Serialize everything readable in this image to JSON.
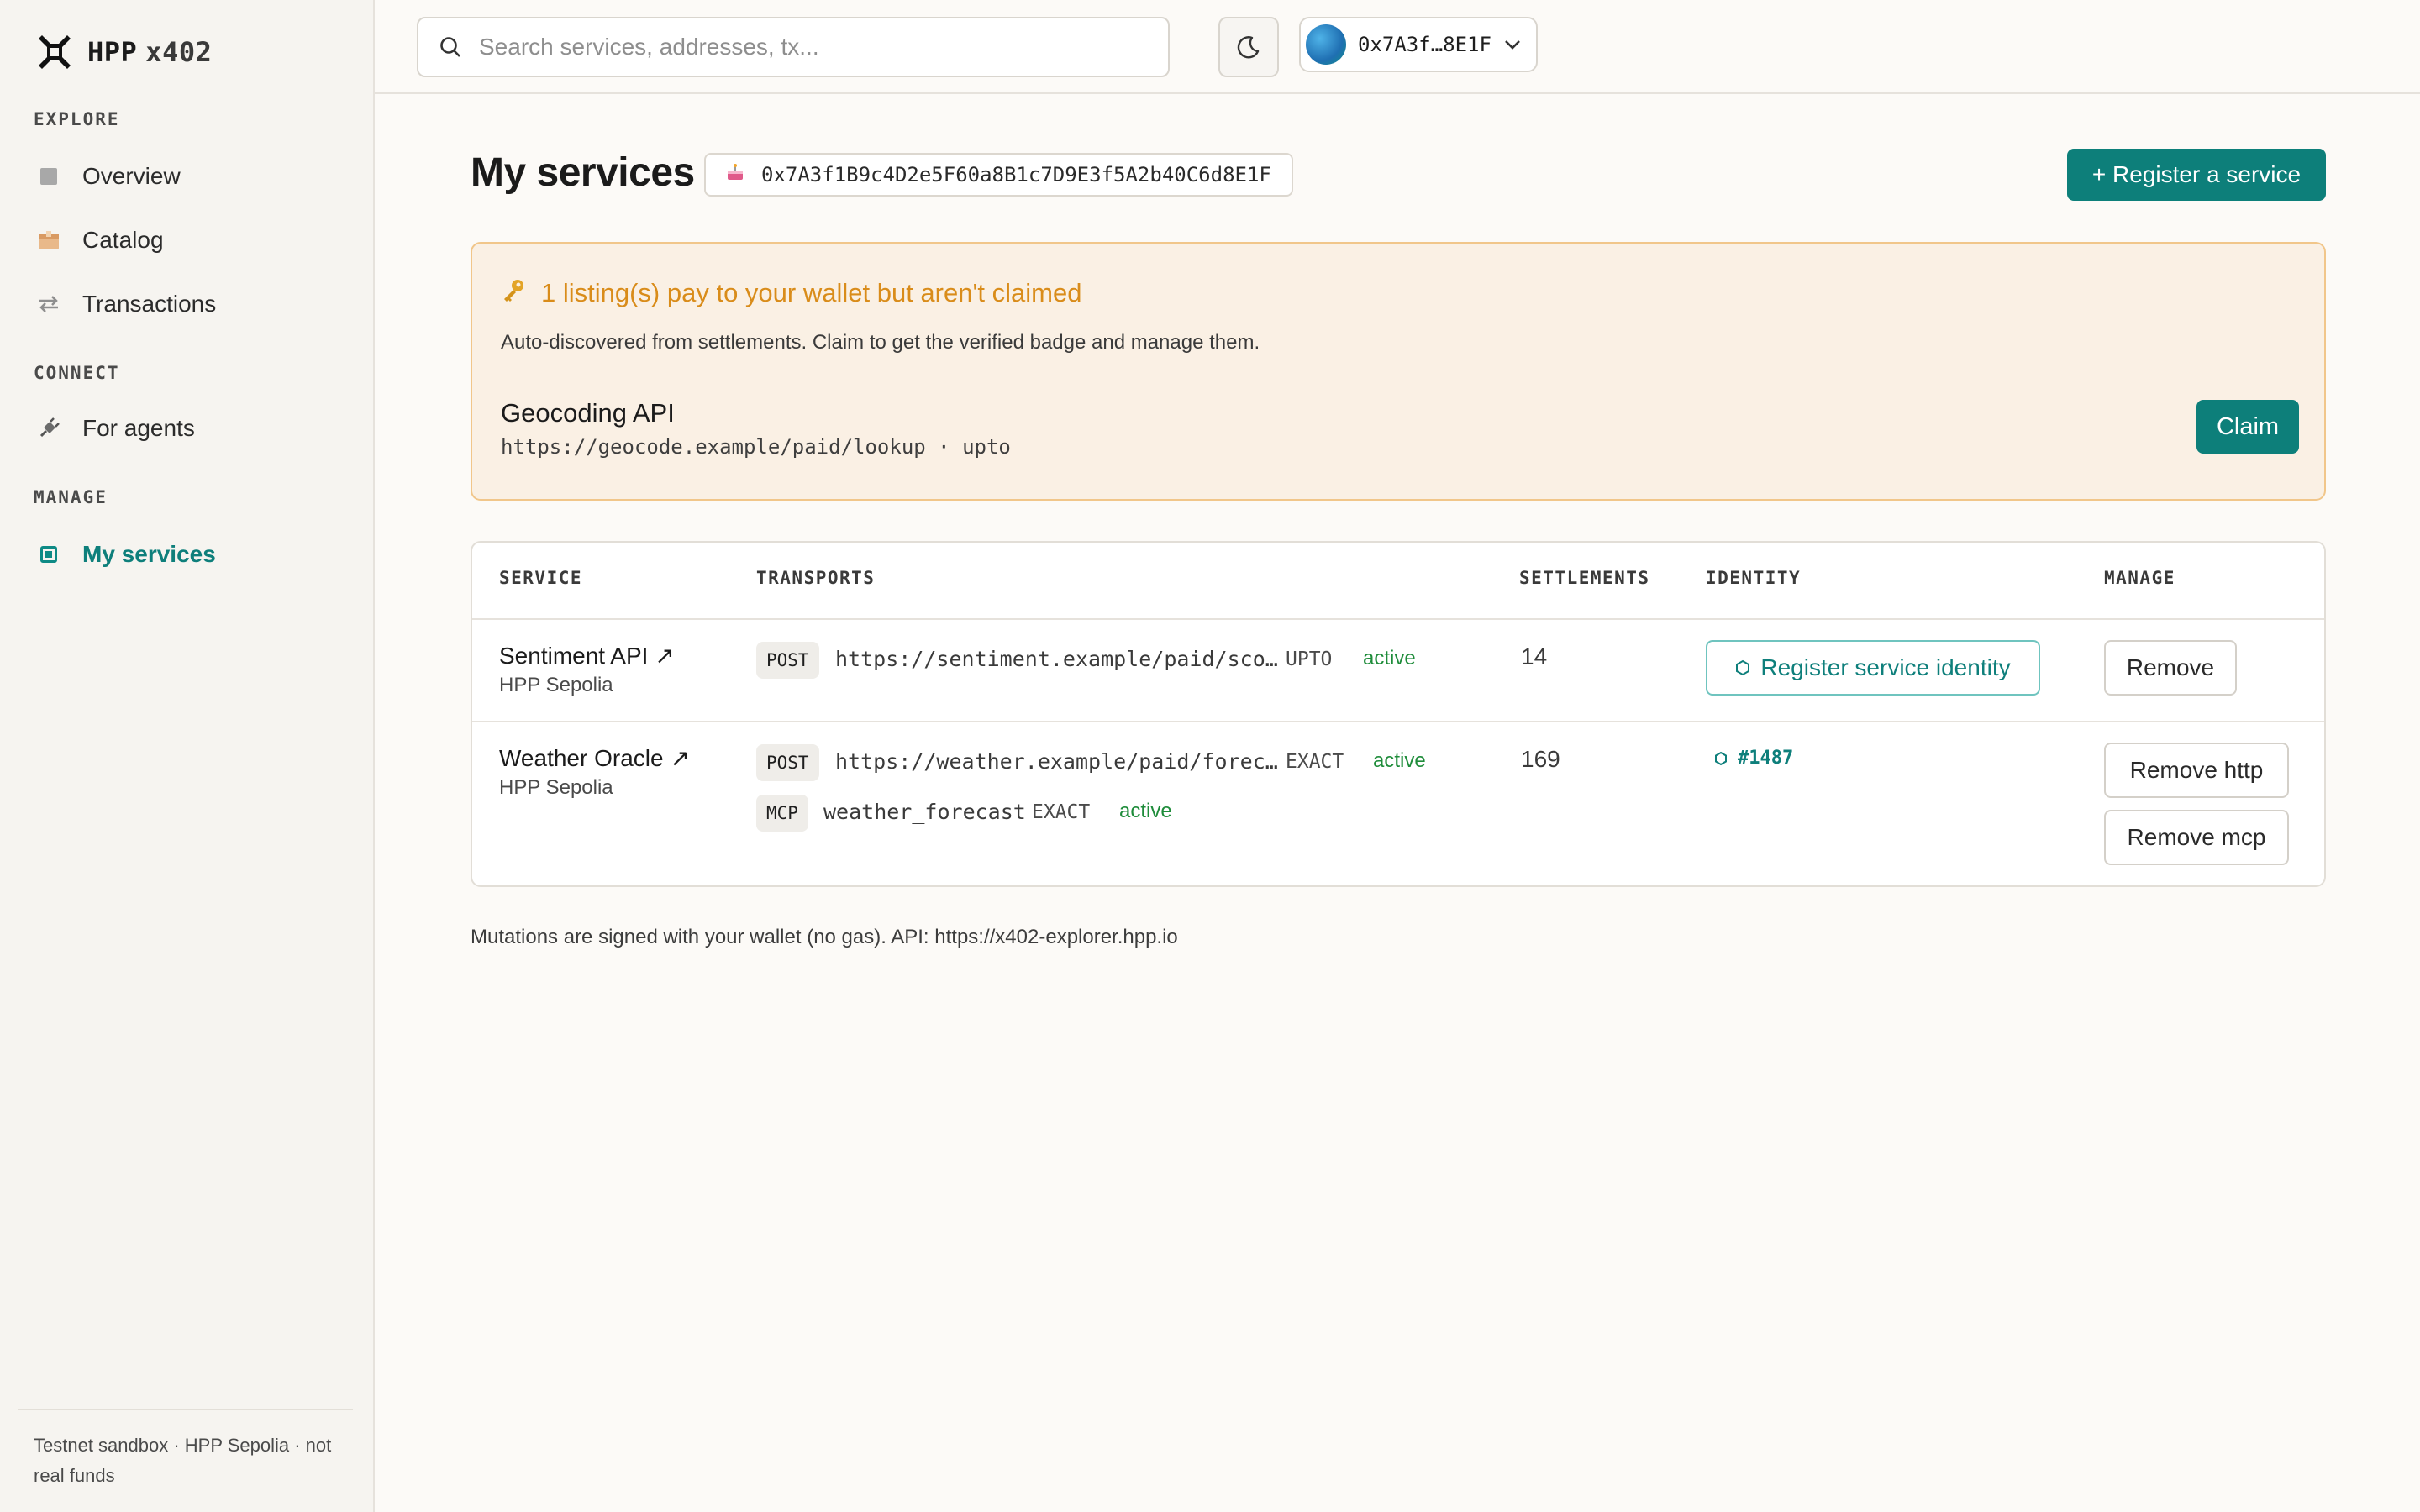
{
  "brand": {
    "name": "HPP",
    "suffix": "x402"
  },
  "sidebar": {
    "sections": {
      "explore": "EXPLORE",
      "connect": "CONNECT",
      "manage": "MANAGE"
    },
    "items": [
      {
        "label": "Overview",
        "icon": "overview-square-icon"
      },
      {
        "label": "Catalog",
        "icon": "box-icon"
      },
      {
        "label": "Transactions",
        "icon": "swap-arrows-icon"
      },
      {
        "label": "For agents",
        "icon": "plug-icon"
      },
      {
        "label": "My services",
        "icon": "services-icon",
        "active": true
      }
    ],
    "footer": "Testnet sandbox · HPP Sepolia · not real funds"
  },
  "topbar": {
    "search_placeholder": "Search services, addresses, tx...",
    "wallet_short": "0x7A3f…8E1F"
  },
  "page": {
    "title": "My services",
    "wallet_full": "0x7A3f1B9c4D2e5F60a8B1c7D9E3f5A2b40C6d8E1F",
    "register_label": "+ Register a service"
  },
  "claim": {
    "title": "1 listing(s) pay to your wallet but aren't claimed",
    "description": "Auto-discovered from settlements. Claim to get the verified badge and manage them.",
    "service_name": "Geocoding API",
    "service_url": "https://geocode.example/paid/lookup · upto",
    "claim_label": "Claim"
  },
  "table": {
    "headers": {
      "service": "SERVICE",
      "transports": "TRANSPORTS",
      "settlements": "SETTLEMENTS",
      "identity": "IDENTITY",
      "manage": "MANAGE"
    },
    "rows": [
      {
        "name": "Sentiment API ↗",
        "network": "HPP Sepolia",
        "transports": [
          {
            "method": "POST",
            "url": "https://sentiment.example/paid/sco…",
            "scheme": "UPTO",
            "status": "active"
          }
        ],
        "settlements": "14",
        "identity_label": "Register service identity",
        "manage": [
          "Remove"
        ]
      },
      {
        "name": "Weather Oracle ↗",
        "network": "HPP Sepolia",
        "transports": [
          {
            "method": "POST",
            "url": "https://weather.example/paid/forec…",
            "scheme": "EXACT",
            "status": "active"
          },
          {
            "method": "MCP",
            "url": "weather_forecast",
            "scheme": "EXACT",
            "status": "active"
          }
        ],
        "settlements": "169",
        "identity_tag": "#1487",
        "manage": [
          "Remove http",
          "Remove mcp"
        ]
      }
    ]
  },
  "footer_note": "Mutations are signed with your wallet (no gas). API: https://x402-explorer.hpp.io",
  "colors": {
    "accent": "#0d7f7a",
    "warning_text": "#d98c1a",
    "warning_bg": "#faf0e4",
    "status_active": "#1e8c3a"
  }
}
